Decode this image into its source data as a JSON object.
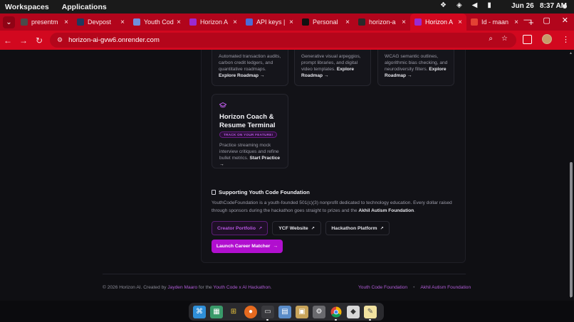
{
  "topbar": {
    "workspaces": "Workspaces",
    "applications": "Applications",
    "date": "Jun 26",
    "time": "8:37 AM"
  },
  "tabs": [
    {
      "title": "presentm",
      "favicon": "globe-icon",
      "color": "#4a4a4a"
    },
    {
      "title": "Devpost",
      "favicon": "devpost-icon",
      "color": "#1e3a5f"
    },
    {
      "title": "Youth Cod",
      "favicon": "sparkle-icon",
      "color": "#6f8fdc"
    },
    {
      "title": "Horizon A",
      "favicon": "horizon-icon",
      "color": "#9b2ad0"
    },
    {
      "title": "API keys |",
      "favicon": "api-icon",
      "color": "#4b6bd6"
    },
    {
      "title": "Personal",
      "favicon": "github-icon",
      "color": "#111111"
    },
    {
      "title": "horizon-a",
      "favicon": "render-icon",
      "color": "#2a2a2a"
    },
    {
      "title": "Horizon A",
      "favicon": "horizon-icon",
      "color": "#9b2ad0",
      "active": true
    },
    {
      "title": "Id - maan",
      "favicon": "gmail-icon",
      "color": "#e34133"
    }
  ],
  "address": {
    "url": "horizon-ai-gvw6.onrender.com"
  },
  "cards_top": [
    {
      "text": "Automated transaction audits, carbon credit ledgers, and quantitative roadmaps.",
      "link": "Explore Roadmap →"
    },
    {
      "text": "Generative visual arpeggios, prompt libraries, and digital video templates.",
      "link": "Explore Roadmap →"
    },
    {
      "text": "WCAG semantic outlines, algorithmic bias checking, and neurodiversity filters.",
      "link": "Explore Roadmap →"
    }
  ],
  "coach_card": {
    "title": "Horizon Coach & Resume Terminal",
    "badge": "TRACK ON YOUR FEATURE!",
    "text": "Practice streaming mock interview critiques and refine bullet metrics.",
    "link": "Start Practice →"
  },
  "ycf": {
    "title": "Supporting Youth Code Foundation",
    "body_prefix": "YouthCodeFoundation is a youth-founded 501(c)(3) nonprofit dedicated to technology education. Every dollar raised through sponsors during the hackathon goes straight to prizes and the ",
    "body_bold": "Akhil Autism Foundation",
    "body_suffix": ".",
    "buttons": {
      "creator_portfolio": "Creator Portfolio",
      "ycf_website": "YCF Website",
      "hackathon_platform": "Hackathon Platform"
    },
    "launch": "Launch Career Matcher"
  },
  "footer": {
    "copyright": "© 2026 Horizon AI. Created by ",
    "author": "Jayden Maaro",
    "for_text": " for the ",
    "event": "Youth Code x AI Hackathon",
    "period": ".",
    "link1": "Youth Code Foundation",
    "sep": "•",
    "link2": "Akhil Autism Foundation"
  },
  "colors": {
    "accent": "#b10fcf",
    "chrome_red": "#d2081f"
  }
}
